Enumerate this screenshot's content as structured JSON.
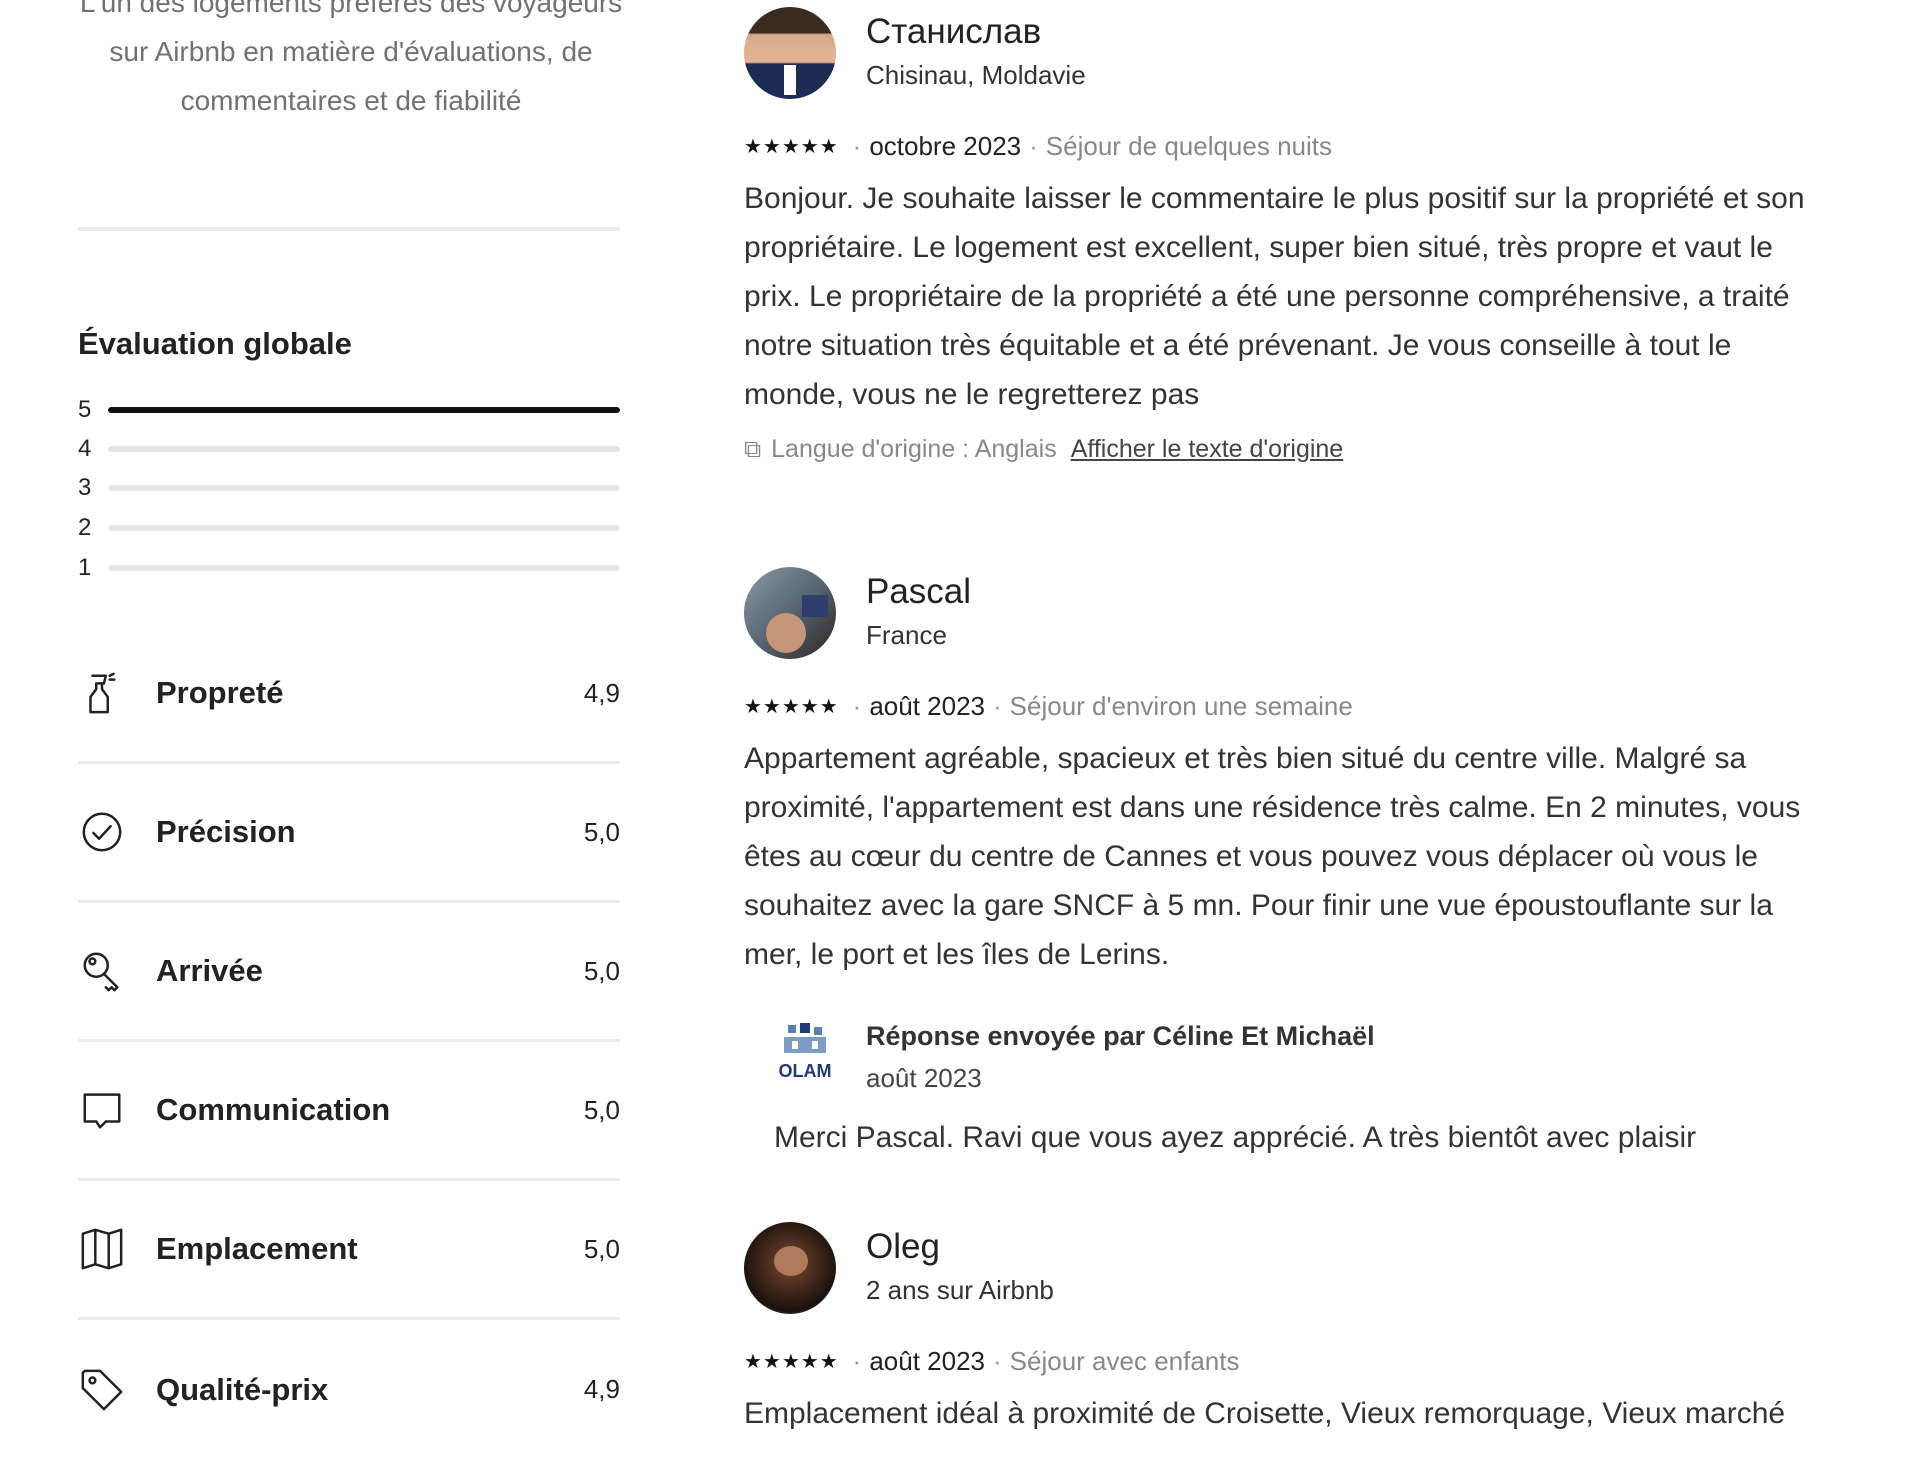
{
  "left": {
    "guest_favorite_text": "L'un des logements préférés des voyageurs sur Airbnb en matière d'évaluations, de commentaires et de fiabilité",
    "overall": {
      "title": "Évaluation globale",
      "bars": [
        {
          "label": "5",
          "fraction": 1.0
        },
        {
          "label": "4",
          "fraction": 0.0
        },
        {
          "label": "3",
          "fraction": 0.0
        },
        {
          "label": "2",
          "fraction": 0.0
        },
        {
          "label": "1",
          "fraction": 0.0
        }
      ]
    },
    "categories": [
      {
        "icon": "spray-bottle-icon",
        "label": "Propreté",
        "value": "4,9"
      },
      {
        "icon": "check-circle-icon",
        "label": "Précision",
        "value": "5,0"
      },
      {
        "icon": "key-icon",
        "label": "Arrivée",
        "value": "5,0"
      },
      {
        "icon": "chat-bubble-icon",
        "label": "Communication",
        "value": "5,0"
      },
      {
        "icon": "map-icon",
        "label": "Emplacement",
        "value": "5,0"
      },
      {
        "icon": "tag-icon",
        "label": "Qualité-prix",
        "value": "4,9"
      }
    ]
  },
  "reviews": [
    {
      "name": "Станислав",
      "subtitle": "Chisinau, Moldavie",
      "stars": "★★★★★",
      "date": "octobre 2023",
      "stay": "Séjour de quelques nuits",
      "text": "Bonjour. Je souhaite laisser le commentaire le plus positif sur la propriété et son propriétaire. Le logement est excellent, super bien situé, très propre et vaut le prix. Le propriétaire de la propriété a été une personne compréhensive, a traité notre situation très équitable et a été prévenant. Je vous conseille à tout le monde, vous ne le regretterez pas",
      "translation_note": "Langue d'origine : Anglais",
      "show_original": "Afficher le texte d'origine"
    },
    {
      "name": "Pascal",
      "subtitle": "France",
      "stars": "★★★★★",
      "date": "août 2023",
      "stay": "Séjour d'environ une semaine",
      "text": "Appartement agréable, spacieux et très bien situé du centre ville. Malgré sa proximité, l'appartement est dans une résidence très calme. En 2 minutes, vous êtes au cœur du centre de Cannes et vous pouvez vous déplacer où vous le souhaitez avec la gare SNCF à 5 mn. Pour finir une vue époustouflante sur la mer, le port et les îles de Lerins.",
      "host_reply": {
        "logo_text": "OLAM",
        "title": "Réponse envoyée par Céline Et Michaël",
        "date": "août 2023",
        "text": "Merci Pascal. Ravi que vous ayez apprécié. A très bientôt avec plaisir"
      }
    },
    {
      "name": "Oleg",
      "subtitle": "2 ans sur Airbnb",
      "stars": "★★★★★",
      "date": "août 2023",
      "stay": "Séjour avec enfants",
      "text": "Emplacement idéal à proximité de Croisette, Vieux remorquage, Vieux marché"
    }
  ]
}
